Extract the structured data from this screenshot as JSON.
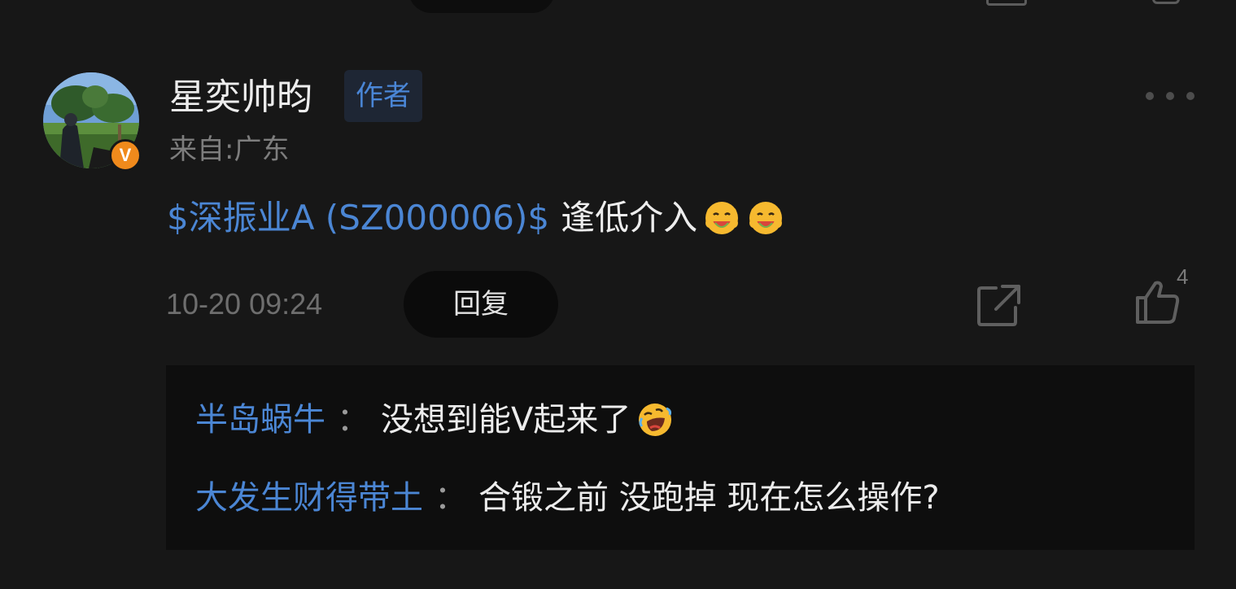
{
  "comment": {
    "username": "星奕帅昀",
    "author_tag": "作者",
    "location": "来自:广东",
    "stock_link": "$深振业A (SZ000006)$",
    "body": "逢低介入",
    "body_emojis": [
      "hungry-face-emoji",
      "hungry-face-emoji"
    ],
    "timestamp": "10-20 09:24",
    "reply_label": "回复",
    "like_count": "4"
  },
  "replies": [
    {
      "author": "半岛蜗牛",
      "separator": "：",
      "content": "没想到能V起来了",
      "emoji": "rolling-laugh-emoji"
    },
    {
      "author": "大发生财得带土",
      "separator": "：",
      "content": "合锻之前 没跑掉 现在怎么操作?"
    }
  ],
  "colors": {
    "background": "#171717",
    "link_blue": "#4b86d4",
    "verified_orange": "#f08a1c",
    "reply_box": "#0e0e0e"
  }
}
